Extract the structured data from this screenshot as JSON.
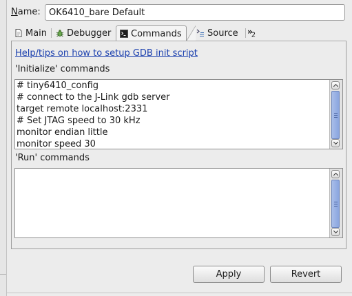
{
  "name_field": {
    "label": "Name:",
    "value": "OK6410_bare Default"
  },
  "tabs": [
    {
      "label": "Main",
      "icon": "document-icon"
    },
    {
      "label": "Debugger",
      "icon": "bug-icon"
    },
    {
      "label": "Commands",
      "icon": "terminal-icon",
      "active": true
    },
    {
      "label": "Source",
      "icon": "source-lookup-icon"
    }
  ],
  "tab_overflow": {
    "chevron": "»",
    "count": "2"
  },
  "help_link": "Help/tips on how to setup GDB init script",
  "init_section": {
    "label": "'Initialize' commands",
    "lines": [
      "# tiny6410_config",
      "# connect to the J-Link gdb server",
      "target remote localhost:2331",
      "# Set JTAG speed to 30 kHz",
      "monitor endian little",
      "monitor speed 30"
    ]
  },
  "run_section": {
    "label": "'Run' commands",
    "lines": []
  },
  "buttons": {
    "apply": "Apply",
    "revert": "Revert"
  },
  "colors": {
    "link": "#1a3fae",
    "scroll_thumb": "#8aa5df",
    "background": "#ececec"
  }
}
